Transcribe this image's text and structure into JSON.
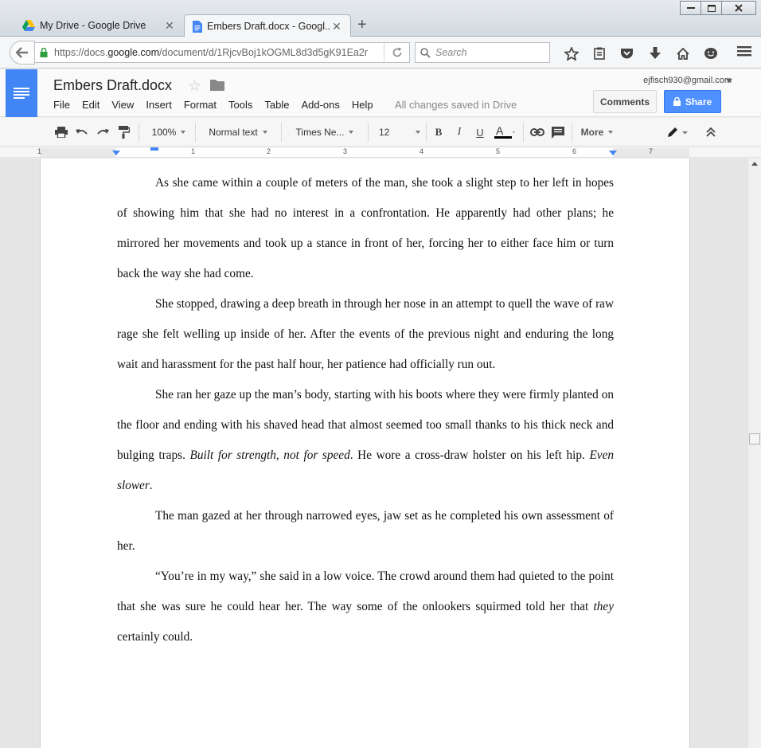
{
  "browser": {
    "tabs": [
      {
        "label": "My Drive - Google Drive",
        "active": false,
        "icon": "google-drive-icon"
      },
      {
        "label": "Embers Draft.docx - Googl...",
        "active": true,
        "icon": "google-docs-icon"
      }
    ],
    "url_prefix": "https://docs.",
    "url_host": "google.com",
    "url_path": "/document/d/1RjcvBoj1kOGML8d3d5gK91Ea2r",
    "search_placeholder": "Search"
  },
  "docs": {
    "title": "Embers Draft.docx",
    "menu": [
      "File",
      "Edit",
      "View",
      "Insert",
      "Format",
      "Tools",
      "Table",
      "Add-ons",
      "Help"
    ],
    "saved_status": "All changes saved in Drive",
    "account": "ejfisch930@gmail.com",
    "comments_label": "Comments",
    "share_label": "Share",
    "accent_color": "#4285f4"
  },
  "toolbar": {
    "zoom": "100%",
    "style": "Normal text",
    "font": "Times Ne...",
    "size": "12",
    "more_label": "More"
  },
  "ruler": {
    "numbers": [
      "1",
      "1",
      "2",
      "3",
      "4",
      "5",
      "6",
      "7"
    ]
  },
  "content": {
    "p1": "As she came within a couple of meters of the man, she took a slight step to her left in hopes of showing him that she had no interest in a confrontation. He apparently had other plans; he mirrored her movements and took up a stance in front of her, forcing her to either face him or turn back the way she had come.",
    "p2": "She stopped, drawing a deep breath in through her nose in an attempt to quell the wave of raw rage she felt welling up inside of her. After the events of the previous night and enduring the long wait and harassment for the past half hour, her patience had officially run out.",
    "p3_a": "She ran her gaze up the man’s body, starting with his boots where they were firmly planted on the floor and ending with his shaved head that almost seemed too small thanks to his thick neck and bulging traps. ",
    "p3_b": "Built for strength, not for speed",
    "p3_c": ". He wore a cross-draw holster on his left hip. ",
    "p3_d": "Even slower",
    "p3_e": ".",
    "p4": "The man gazed at her through narrowed eyes, jaw set as he completed his own assessment of her.",
    "p5_a": "“You’re in my way,” she said in a low voice. The crowd around them had quieted to the point that she was sure he could hear her. The way some of the onlookers squirmed told her that ",
    "p5_b": "they",
    "p5_c": " certainly could."
  }
}
